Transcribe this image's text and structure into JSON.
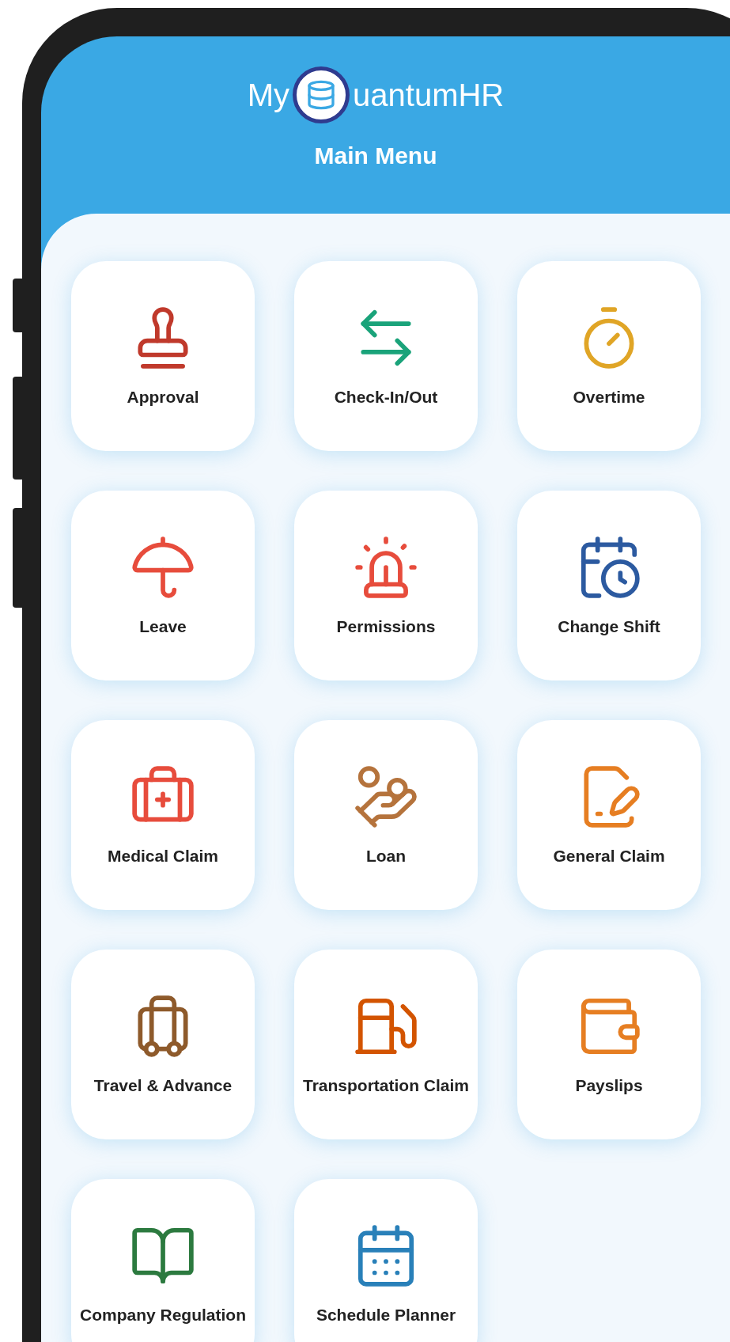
{
  "header": {
    "logo_left": "My",
    "logo_right": "uantumHR",
    "title": "Main Menu"
  },
  "menu": [
    {
      "label": "Approval"
    },
    {
      "label": "Check-In/Out"
    },
    {
      "label": "Overtime"
    },
    {
      "label": "Leave"
    },
    {
      "label": "Permissions"
    },
    {
      "label": "Change Shift"
    },
    {
      "label": "Medical Claim"
    },
    {
      "label": "Loan"
    },
    {
      "label": "General Claim"
    },
    {
      "label": "Travel & Advance"
    },
    {
      "label": "Transportation Claim"
    },
    {
      "label": "Payslips"
    },
    {
      "label": "Company Regulation"
    },
    {
      "label": "Schedule Planner"
    }
  ]
}
